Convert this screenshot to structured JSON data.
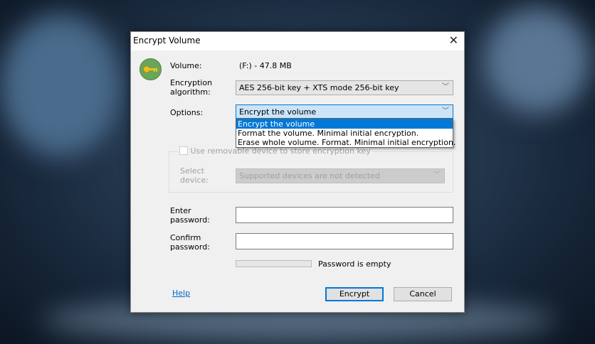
{
  "dialog": {
    "title": "Encrypt Volume"
  },
  "volume": {
    "label": "Volume:",
    "value": "(F:) - 47.8 MB"
  },
  "algorithm": {
    "label_line1": "Encryption",
    "label_line2": "algorithm:",
    "value": "AES 256-bit key + XTS mode 256-bit key"
  },
  "options": {
    "label": "Options:",
    "value": "Encrypt the volume",
    "items": [
      "Encrypt the volume",
      "Format the volume. Minimal initial encryption.",
      "Erase whole volume. Format. Minimal initial encryption."
    ]
  },
  "removable": {
    "checkbox_label": "Use removable device to store encryption key",
    "checked": false,
    "device_label_line1": "Select",
    "device_label_line2": "device:",
    "device_value": "Supported devices are not detected"
  },
  "password": {
    "enter_line1": "Enter",
    "enter_line2": "password:",
    "enter_value": "",
    "confirm_line1": "Confirm",
    "confirm_line2": "password:",
    "confirm_value": "",
    "strength_percent": 0,
    "strength_text": "Password is empty"
  },
  "footer": {
    "help": "Help",
    "encrypt": "Encrypt",
    "cancel": "Cancel"
  }
}
